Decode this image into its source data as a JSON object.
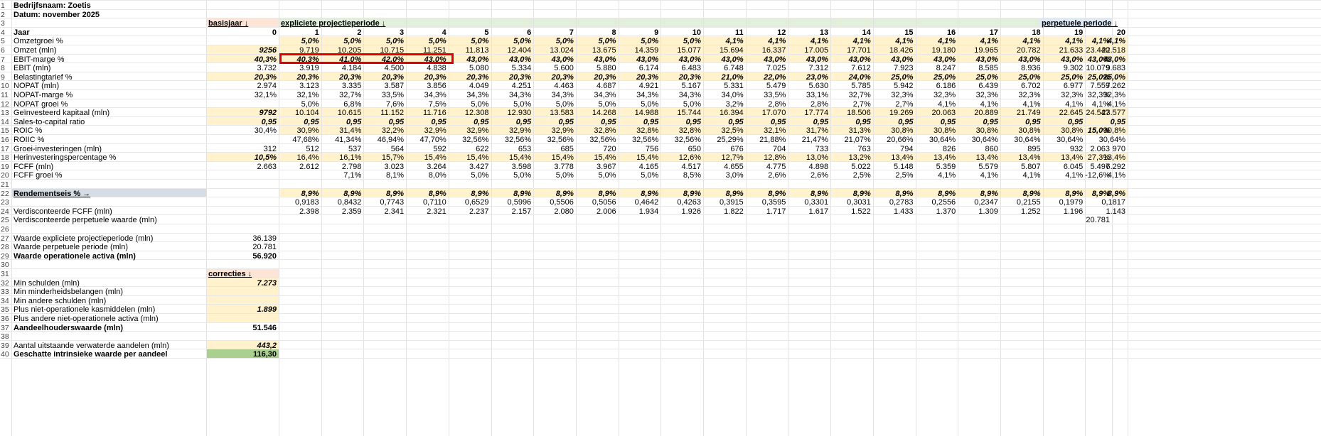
{
  "colors": {
    "input_fill": "#fff2cc",
    "header_basis": "#fce4d6",
    "header_explicit": "#e2efda",
    "header_perp": "#ddebf7",
    "header_rend": "#d6dce4",
    "result_green": "#a9d08e",
    "highlight_border": "#e00000"
  },
  "row_numbers": [
    "1",
    "2",
    "3",
    "4",
    "5",
    "6",
    "7",
    "8",
    "9",
    "10",
    "11",
    "12",
    "13",
    "14",
    "15",
    "16",
    "17",
    "18",
    "19",
    "20",
    "21",
    "22",
    "23",
    "24",
    "25",
    "26",
    "27",
    "28",
    "29",
    "30",
    "31",
    "32",
    "33",
    "34",
    "35",
    "36",
    "37",
    "38",
    "39",
    "40"
  ],
  "header": {
    "company": "Bedrijfsnaam: Zoetis",
    "date": "Datum: november 2025",
    "basisjaar": "basisjaar ↓",
    "explicit": "expliciete projectieperiode ↓",
    "perpetual": "perpetuele periode ↓",
    "jaar": "Jaar",
    "years": [
      "0",
      "1",
      "2",
      "3",
      "4",
      "5",
      "6",
      "7",
      "8",
      "9",
      "10",
      "11",
      "12",
      "13",
      "14",
      "15",
      "16",
      "17",
      "18",
      "19",
      "20"
    ]
  },
  "rows": [
    {
      "label": "Omzetgroei %",
      "base": "",
      "vals": [
        "5,0%",
        "5,0%",
        "5,0%",
        "5,0%",
        "5,0%",
        "5,0%",
        "5,0%",
        "5,0%",
        "5,0%",
        "5,0%",
        "4,1%",
        "4,1%",
        "4,1%",
        "4,1%",
        "4,1%",
        "4,1%",
        "4,1%",
        "4,1%",
        "4,1%",
        "4,1%"
      ],
      "perp": "4,1%"
    },
    {
      "label": "Omzet (mln)",
      "base": "9256",
      "vals": [
        "9.719",
        "10.205",
        "10.715",
        "11.251",
        "11.813",
        "12.404",
        "13.024",
        "13.675",
        "14.359",
        "15.077",
        "15.694",
        "16.337",
        "17.005",
        "17.701",
        "18.426",
        "19.180",
        "19.965",
        "20.782",
        "21.633",
        "22.518"
      ],
      "perp": "23.440"
    },
    {
      "label": "EBIT-marge %",
      "base": "40,3%",
      "vals": [
        "40,3%",
        "41,0%",
        "42,0%",
        "43,0%",
        "43,0%",
        "43,0%",
        "43,0%",
        "43,0%",
        "43,0%",
        "43,0%",
        "43,0%",
        "43,0%",
        "43,0%",
        "43,0%",
        "43,0%",
        "43,0%",
        "43,0%",
        "43,0%",
        "43,0%",
        "43,0%"
      ],
      "perp": "43,0%"
    },
    {
      "label": "EBIT (mln)",
      "base": "3.732",
      "vals": [
        "3.919",
        "4.184",
        "4.500",
        "4.838",
        "5.080",
        "5.334",
        "5.600",
        "5.880",
        "6.174",
        "6.483",
        "6.748",
        "7.025",
        "7.312",
        "7.612",
        "7.923",
        "8.247",
        "8.585",
        "8.936",
        "9.302",
        "9.683"
      ],
      "perp": "10.079"
    },
    {
      "label": "Belastingtarief %",
      "base": "20,3%",
      "vals": [
        "20,3%",
        "20,3%",
        "20,3%",
        "20,3%",
        "20,3%",
        "20,3%",
        "20,3%",
        "20,3%",
        "20,3%",
        "20,3%",
        "21,0%",
        "22,0%",
        "23,0%",
        "24,0%",
        "25,0%",
        "25,0%",
        "25,0%",
        "25,0%",
        "25,0%",
        "25,0%"
      ],
      "perp": "25,0%"
    },
    {
      "label": "NOPAT (mln)",
      "base": "2.974",
      "vals": [
        "3.123",
        "3.335",
        "3.587",
        "3.856",
        "4.049",
        "4.251",
        "4.463",
        "4.687",
        "4.921",
        "5.167",
        "5.331",
        "5.479",
        "5.630",
        "5.785",
        "5.942",
        "6.186",
        "6.439",
        "6.702",
        "6.977",
        "7.262"
      ],
      "perp": "7.559"
    },
    {
      "label": "NOPAT-marge %",
      "base": "32,1%",
      "vals": [
        "32,1%",
        "32,7%",
        "33,5%",
        "34,3%",
        "34,3%",
        "34,3%",
        "34,3%",
        "34,3%",
        "34,3%",
        "34,3%",
        "34,0%",
        "33,5%",
        "33,1%",
        "32,7%",
        "32,3%",
        "32,3%",
        "32,3%",
        "32,3%",
        "32,3%",
        "32,3%"
      ],
      "perp": "32,3%"
    },
    {
      "label": "NOPAT groei %",
      "base": "",
      "vals": [
        "5,0%",
        "6,8%",
        "7,6%",
        "7,5%",
        "5,0%",
        "5,0%",
        "5,0%",
        "5,0%",
        "5,0%",
        "5,0%",
        "3,2%",
        "2,8%",
        "2,8%",
        "2,7%",
        "2,7%",
        "4,1%",
        "4,1%",
        "4,1%",
        "4,1%",
        "4,1%"
      ],
      "perp": "4,1%"
    },
    {
      "label": "Geïnvesteerd kapitaal (mln)",
      "base": "9792",
      "vals": [
        "10.104",
        "10.615",
        "11.152",
        "11.716",
        "12.308",
        "12.930",
        "13.583",
        "14.268",
        "14.988",
        "15.744",
        "16.394",
        "17.070",
        "17.774",
        "18.506",
        "19.269",
        "20.063",
        "20.889",
        "21.749",
        "22.645",
        "23.577"
      ],
      "perp": "24.547"
    },
    {
      "label": "Sales-to-capital ratio",
      "base": "0,95",
      "vals": [
        "0,95",
        "0,95",
        "0,95",
        "0,95",
        "0,95",
        "0,95",
        "0,95",
        "0,95",
        "0,95",
        "0,95",
        "0,95",
        "0,95",
        "0,95",
        "0,95",
        "0,95",
        "0,95",
        "0,95",
        "0,95",
        "0,95",
        "0,95"
      ],
      "perp": ""
    },
    {
      "label": "ROIC %",
      "base": "30,4%",
      "vals": [
        "30,9%",
        "31,4%",
        "32,2%",
        "32,9%",
        "32,9%",
        "32,9%",
        "32,9%",
        "32,8%",
        "32,8%",
        "32,8%",
        "32,5%",
        "32,1%",
        "31,7%",
        "31,3%",
        "30,8%",
        "30,8%",
        "30,8%",
        "30,8%",
        "30,8%",
        "30,8%"
      ],
      "perp": "15,0%"
    },
    {
      "label": "ROIIC %",
      "base": "",
      "vals": [
        "47,68%",
        "41,34%",
        "46,94%",
        "47,70%",
        "32,56%",
        "32,56%",
        "32,56%",
        "32,56%",
        "32,56%",
        "32,56%",
        "25,29%",
        "21,88%",
        "21,47%",
        "21,07%",
        "20,66%",
        "30,64%",
        "30,64%",
        "30,64%",
        "30,64%",
        "30,64%"
      ],
      "perp": ""
    },
    {
      "label": "Groei-investeringen (mln)",
      "base": "312",
      "vals": [
        "512",
        "537",
        "564",
        "592",
        "622",
        "653",
        "685",
        "720",
        "756",
        "650",
        "676",
        "704",
        "733",
        "763",
        "794",
        "826",
        "860",
        "895",
        "932",
        "970"
      ],
      "perp": "2.063"
    },
    {
      "label": "Herinvesteringspercentage %",
      "base": "10,5%",
      "vals": [
        "16,4%",
        "16,1%",
        "15,7%",
        "15,4%",
        "15,4%",
        "15,4%",
        "15,4%",
        "15,4%",
        "15,4%",
        "12,6%",
        "12,7%",
        "12,8%",
        "13,0%",
        "13,2%",
        "13,4%",
        "13,4%",
        "13,4%",
        "13,4%",
        "13,4%",
        "13,4%"
      ],
      "perp": "27,3%"
    },
    {
      "label": "FCFF (mln)",
      "base": "2.663",
      "vals": [
        "2.612",
        "2.798",
        "3.023",
        "3.264",
        "3.427",
        "3.598",
        "3.778",
        "3.967",
        "4.165",
        "4.517",
        "4.655",
        "4.775",
        "4.898",
        "5.022",
        "5.148",
        "5.359",
        "5.579",
        "5.807",
        "6.045",
        "6.292"
      ],
      "perp": "5.497"
    },
    {
      "label": "FCFF groei %",
      "base": "",
      "vals": [
        "",
        "7,1%",
        "8,1%",
        "8,0%",
        "5,0%",
        "5,0%",
        "5,0%",
        "5,0%",
        "5,0%",
        "8,5%",
        "3,0%",
        "2,6%",
        "2,6%",
        "2,5%",
        "2,5%",
        "4,1%",
        "4,1%",
        "4,1%",
        "4,1%",
        "4,1%"
      ],
      "perp": "-12,6%"
    }
  ],
  "rendement": {
    "label": "Rendementseis % →",
    "vals": [
      "8,9%",
      "8,9%",
      "8,9%",
      "8,9%",
      "8,9%",
      "8,9%",
      "8,9%",
      "8,9%",
      "8,9%",
      "8,9%",
      "8,9%",
      "8,9%",
      "8,9%",
      "8,9%",
      "8,9%",
      "8,9%",
      "8,9%",
      "8,9%",
      "8,9%",
      "8,9%"
    ],
    "perp": "8,9%"
  },
  "discount": [
    "0,9183",
    "0,8432",
    "0,7743",
    "0,7110",
    "0,6529",
    "0,5996",
    "0,5506",
    "0,5056",
    "0,4642",
    "0,4263",
    "0,3915",
    "0,3595",
    "0,3301",
    "0,3031",
    "0,2783",
    "0,2556",
    "0,2347",
    "0,2155",
    "0,1979",
    "0,1817"
  ],
  "disc_fcff": {
    "label": "Verdisconteerde FCFF (mln)",
    "vals": [
      "2.398",
      "2.359",
      "2.341",
      "2.321",
      "2.237",
      "2.157",
      "2.080",
      "2.006",
      "1.934",
      "1.926",
      "1.822",
      "1.717",
      "1.617",
      "1.522",
      "1.433",
      "1.370",
      "1.309",
      "1.252",
      "1.196",
      "1.143"
    ]
  },
  "disc_perp": {
    "label": "Verdisconteerde perpetuele waarde (mln)",
    "value": "20.781"
  },
  "valuation": [
    {
      "label": "Waarde expliciete projectieperiode (mln)",
      "value": "36.139",
      "bold": false
    },
    {
      "label": "Waarde perpetuele periode (mln)",
      "value": "20.781",
      "bold": false
    },
    {
      "label": "Waarde operationele activa (mln)",
      "value": "56.920",
      "bold": true
    }
  ],
  "corrections_header": "correcties ↓",
  "corrections": [
    {
      "label": "Min schulden (mln)",
      "value": "7.273"
    },
    {
      "label": "Min minderheidsbelangen (mln)",
      "value": ""
    },
    {
      "label": "Min andere schulden (mln)",
      "value": ""
    },
    {
      "label": "Plus niet-operationele kasmiddelen (mln)",
      "value": "1.899"
    },
    {
      "label": "Plus andere niet-operationele activa (mln)",
      "value": ""
    }
  ],
  "equity": {
    "label": "Aandeelhouderswaarde (mln)",
    "value": "51.546"
  },
  "shares": {
    "label": "Aantal uitstaande verwaterde aandelen (mln)",
    "value": "443,2"
  },
  "intrinsic": {
    "label": "Geschatte intrinsieke waarde per aandeel",
    "value": "116,30"
  }
}
